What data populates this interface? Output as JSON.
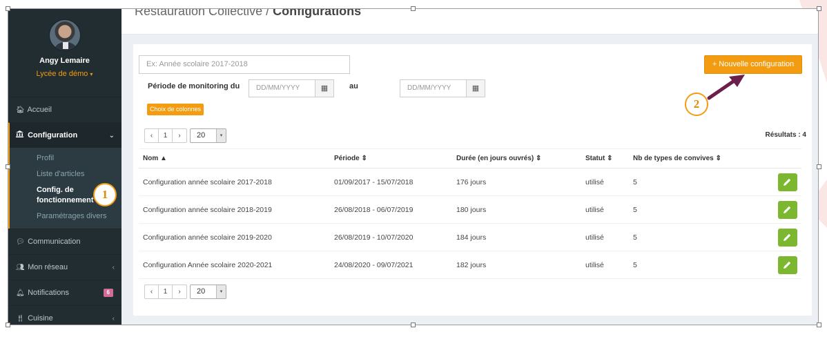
{
  "user": {
    "name": "Angy Lemaire",
    "school": "Lycée de démo",
    "school_caret": "▾"
  },
  "sidebar": {
    "items": [
      {
        "label": "Accueil",
        "icon": "home-icon"
      },
      {
        "label": "Configuration",
        "icon": "institution-icon",
        "arrow": "⌄"
      },
      {
        "label": "Communication",
        "icon": "comments-icon"
      },
      {
        "label": "Mon réseau",
        "icon": "users-icon",
        "arrow": "‹"
      },
      {
        "label": "Notifications",
        "icon": "bell-icon",
        "badge": "6"
      },
      {
        "label": "Cuisine",
        "icon": "cutlery-icon",
        "arrow": "‹"
      }
    ],
    "submenu": [
      {
        "label": "Profil"
      },
      {
        "label": "Liste d'articles"
      },
      {
        "label": "Config. de fonctionnement"
      },
      {
        "label": "Paramétrages divers"
      }
    ]
  },
  "header": {
    "breadcrumb_section": "Restauration Collective",
    "breadcrumb_separator": "/",
    "breadcrumb_page": "Configurations"
  },
  "toolbar": {
    "search_placeholder": "Ex: Année scolaire 2017-2018",
    "new_config_label": "+ Nouvelle configuration",
    "period_label": "Période de monitoring du",
    "period_to_label": "au",
    "date_placeholder": "DD/MM/YYYY",
    "columns_button": "Choix de colonnes",
    "results_label": "Résultats : 4"
  },
  "pagination": {
    "prev": "‹",
    "page": "1",
    "next": "›",
    "page_size": "20",
    "page_size_arrow": "▾"
  },
  "table": {
    "headers": [
      "Nom ▲",
      "Période ⇕",
      "Durée (en jours ouvrés) ⇕",
      "Statut ⇕",
      "Nb de types de convives ⇕"
    ],
    "rows": [
      [
        "Configuration année scolaire 2017-2018",
        "01/09/2017 - 15/07/2018",
        "176 jours",
        "utilisé",
        "5"
      ],
      [
        "Configuration année scolaire 2018-2019",
        "26/08/2018 - 06/07/2019",
        "180 jours",
        "utilisé",
        "5"
      ],
      [
        "Configuration année scolaire 2019-2020",
        "26/08/2019 - 10/07/2020",
        "184 jours",
        "utilisé",
        "5"
      ],
      [
        "Configuration Année scolaire 2020-2021",
        "24/08/2020 - 09/07/2021",
        "182 jours",
        "utilisé",
        "5"
      ]
    ]
  },
  "annotations": {
    "step1": "1",
    "step2": "2"
  },
  "colors": {
    "accent": "#f39c12",
    "sidebar_bg": "#222d32",
    "edit_button": "#7cb82f",
    "arrow": "#6b1f4a"
  }
}
